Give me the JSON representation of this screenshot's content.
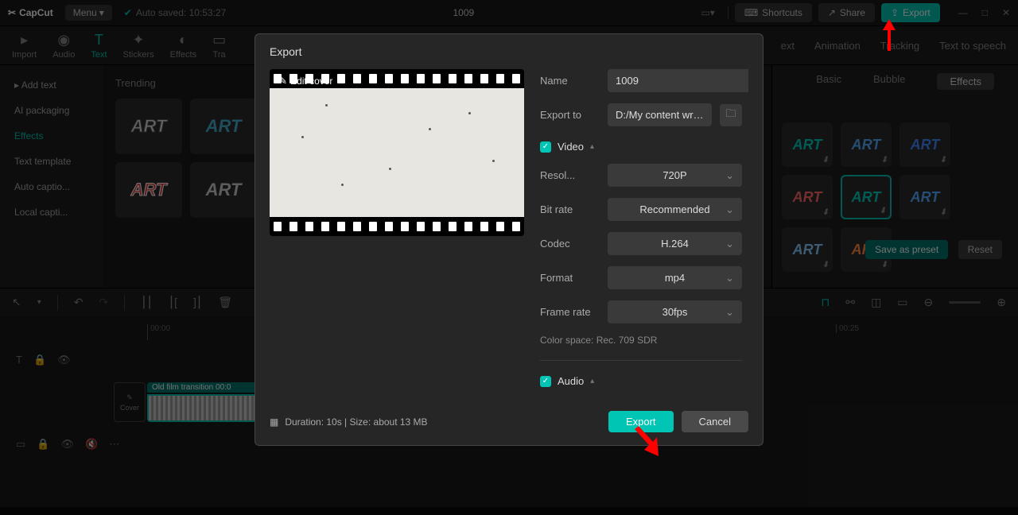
{
  "app": {
    "name": "CapCut",
    "menu": "Menu",
    "autosave": "Auto saved: 10:53:27",
    "project": "1009"
  },
  "titlebar": {
    "shortcuts": "Shortcuts",
    "share": "Share",
    "export": "Export"
  },
  "toptabs": {
    "left": [
      "Import",
      "Audio",
      "Text",
      "Stickers",
      "Effects",
      "Tra"
    ],
    "right": [
      "ext",
      "Animation",
      "Tracking",
      "Text to speech"
    ]
  },
  "sidebar": [
    "Add text",
    "AI packaging",
    "Effects",
    "Text template",
    "Auto captio...",
    "Local capti..."
  ],
  "content": {
    "section": "Trending",
    "sample": "ART"
  },
  "rightpanel": {
    "tabs": [
      "Basic",
      "Bubble",
      "Effects"
    ],
    "save": "Save as preset",
    "reset": "Reset"
  },
  "timeline": {
    "ruler": [
      "00:00",
      "00:25"
    ],
    "cover": "Cover",
    "clip": "Old film transition   00:0"
  },
  "modal": {
    "title": "Export",
    "editcover": "Edit cover",
    "name_label": "Name",
    "name_value": "1009",
    "exportto_label": "Export to",
    "exportto_value": "D:/My content writin...",
    "video_section": "Video",
    "resolution_label": "Resol...",
    "resolution_value": "720P",
    "bitrate_label": "Bit rate",
    "bitrate_value": "Recommended",
    "codec_label": "Codec",
    "codec_value": "H.264",
    "format_label": "Format",
    "format_value": "mp4",
    "framerate_label": "Frame rate",
    "framerate_value": "30fps",
    "colorspace": "Color space: Rec. 709 SDR",
    "audio_section": "Audio",
    "duration": "Duration: 10s | Size: about 13 MB",
    "export_btn": "Export",
    "cancel_btn": "Cancel"
  }
}
